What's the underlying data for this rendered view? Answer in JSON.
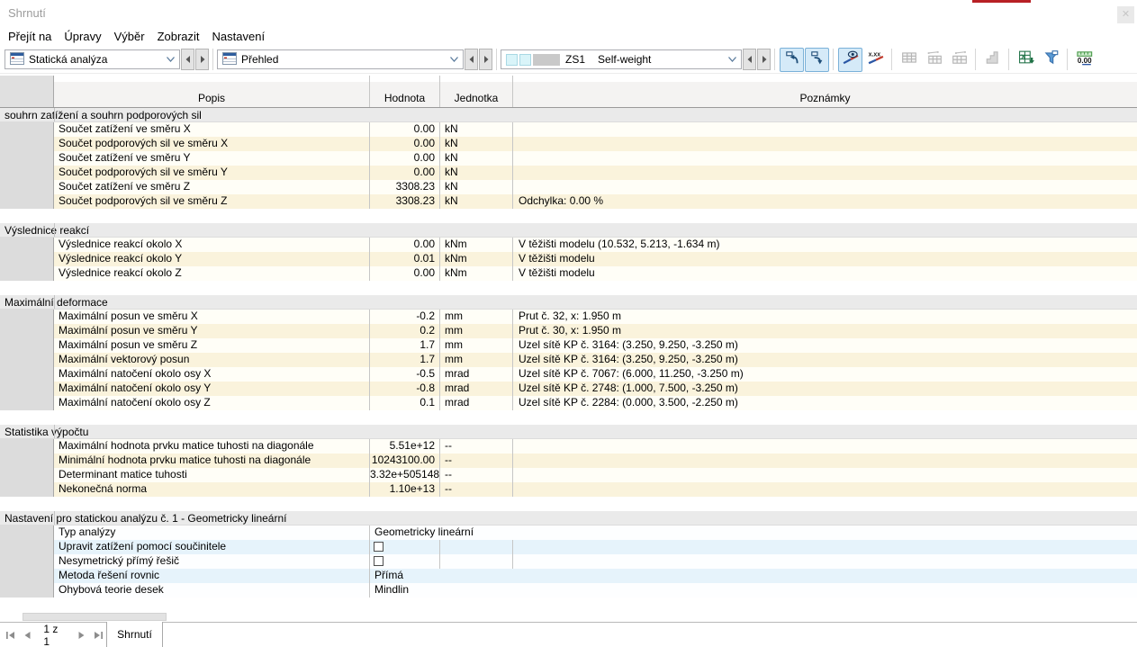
{
  "window": {
    "title": "Shrnutí",
    "close_glyph": "✕"
  },
  "menu": {
    "items": [
      "Přejít na",
      "Úpravy",
      "Výběr",
      "Zobrazit",
      "Nastavení"
    ]
  },
  "toolbar": {
    "combo1_value": "Statická analýza",
    "combo2_value": "Přehled",
    "loadcase_label": "ZS1",
    "loadcase_value": "Self-weight",
    "buttons": [
      {
        "name": "jump-back",
        "active": true
      },
      {
        "name": "jump-forward",
        "active": true
      },
      {
        "sep": true
      },
      {
        "name": "show-values",
        "active": true
      },
      {
        "name": "decimal-display"
      },
      {
        "sep": true
      },
      {
        "name": "table-grid",
        "disabled": true
      },
      {
        "name": "table-insert-row",
        "disabled": true
      },
      {
        "name": "table-insert-col",
        "disabled": true
      },
      {
        "sep": true
      },
      {
        "name": "chart",
        "disabled": true
      },
      {
        "sep": true
      },
      {
        "name": "excel-export"
      },
      {
        "name": "filter"
      },
      {
        "sep": true
      },
      {
        "name": "units-decimals"
      }
    ]
  },
  "table": {
    "headers": {
      "popis": "Popis",
      "hodnota": "Hodnota",
      "jednotka": "Jednotka",
      "poznamky": "Poznámky"
    },
    "sections": [
      {
        "title": "souhrn zatížení a souhrn podporových sil",
        "theme": "cream",
        "rows": [
          {
            "popis": "Součet zatížení ve směru X",
            "hodnota": "0.00",
            "jednotka": "kN",
            "poznamky": ""
          },
          {
            "popis": "Součet podporových sil ve směru X",
            "hodnota": "0.00",
            "jednotka": "kN",
            "poznamky": ""
          },
          {
            "popis": "Součet zatížení ve směru Y",
            "hodnota": "0.00",
            "jednotka": "kN",
            "poznamky": ""
          },
          {
            "popis": "Součet podporových sil ve směru Y",
            "hodnota": "0.00",
            "jednotka": "kN",
            "poznamky": ""
          },
          {
            "popis": "Součet zatížení ve směru Z",
            "hodnota": "3308.23",
            "jednotka": "kN",
            "poznamky": ""
          },
          {
            "popis": "Součet podporových sil ve směru Z",
            "hodnota": "3308.23",
            "jednotka": "kN",
            "poznamky": "Odchylka: 0.00 %"
          }
        ]
      },
      {
        "title": "Výslednice reakcí",
        "theme": "cream",
        "rows": [
          {
            "popis": "Výslednice reakcí okolo X",
            "hodnota": "0.00",
            "jednotka": "kNm",
            "poznamky": "V těžišti modelu (10.532, 5.213, -1.634 m)"
          },
          {
            "popis": "Výslednice reakcí okolo Y",
            "hodnota": "0.01",
            "jednotka": "kNm",
            "poznamky": "V těžišti modelu"
          },
          {
            "popis": "Výslednice reakcí okolo Z",
            "hodnota": "0.00",
            "jednotka": "kNm",
            "poznamky": "V těžišti modelu"
          }
        ]
      },
      {
        "title": "Maximální deformace",
        "theme": "cream",
        "rows": [
          {
            "popis": "Maximální posun ve směru X",
            "hodnota": "-0.2",
            "jednotka": "mm",
            "poznamky": "Prut č. 32, x: 1.950 m"
          },
          {
            "popis": "Maximální posun ve směru Y",
            "hodnota": "0.2",
            "jednotka": "mm",
            "poznamky": "Prut č. 30, x: 1.950 m"
          },
          {
            "popis": "Maximální posun ve směru Z",
            "hodnota": "1.7",
            "jednotka": "mm",
            "poznamky": "Uzel sítě KP č. 3164: (3.250, 9.250, -3.250 m)"
          },
          {
            "popis": "Maximální vektorový posun",
            "hodnota": "1.7",
            "jednotka": "mm",
            "poznamky": "Uzel sítě KP č. 3164: (3.250, 9.250, -3.250 m)"
          },
          {
            "popis": "Maximální natočení okolo osy X",
            "hodnota": "-0.5",
            "jednotka": "mrad",
            "poznamky": "Uzel sítě KP č. 7067: (6.000, 11.250, -3.250 m)"
          },
          {
            "popis": "Maximální natočení okolo osy Y",
            "hodnota": "-0.8",
            "jednotka": "mrad",
            "poznamky": "Uzel sítě KP č. 2748: (1.000, 7.500, -3.250 m)"
          },
          {
            "popis": "Maximální natočení okolo osy Z",
            "hodnota": "0.1",
            "jednotka": "mrad",
            "poznamky": "Uzel sítě KP č. 2284: (0.000, 3.500, -2.250 m)"
          }
        ]
      },
      {
        "title": "Statistika výpočtu",
        "theme": "cream",
        "rows": [
          {
            "popis": "Maximální hodnota prvku matice tuhosti na diagonále",
            "hodnota": "5.51e+12",
            "jednotka": "--",
            "poznamky": ""
          },
          {
            "popis": "Minimální hodnota prvku matice tuhosti na diagonále",
            "hodnota": "10243100.00",
            "jednotka": "--",
            "poznamky": ""
          },
          {
            "popis": "Determinant matice tuhosti",
            "hodnota": "3.32e+505148",
            "jednotka": "--",
            "poznamky": ""
          },
          {
            "popis": "Nekonečná norma",
            "hodnota": "1.10e+13",
            "jednotka": "--",
            "poznamky": ""
          }
        ]
      },
      {
        "title": "Nastavení pro statickou analýzu č. 1 - Geometricky lineární",
        "theme": "blue",
        "rows": [
          {
            "popis": "Typ analýzy",
            "value": "Geometricky lineární",
            "span": true
          },
          {
            "popis": "Upravit zatížení pomocí součinitele",
            "checkbox": true
          },
          {
            "popis": "Nesymetrický přímý řešič",
            "checkbox": true
          },
          {
            "popis": "Metoda řešení rovnic",
            "value": "Přímá",
            "span": true
          },
          {
            "popis": "Ohybová teorie desek",
            "value": "Mindlin",
            "span": true
          }
        ]
      }
    ],
    "colors": {
      "cream_even": "#FFFEF7",
      "cream_odd": "#FAF3DC",
      "blue_even": "#FDFEFF",
      "blue_odd": "#E6F3FB"
    }
  },
  "statusbar": {
    "page_label": "1 z 1",
    "tab_label": "Shrnutí"
  }
}
